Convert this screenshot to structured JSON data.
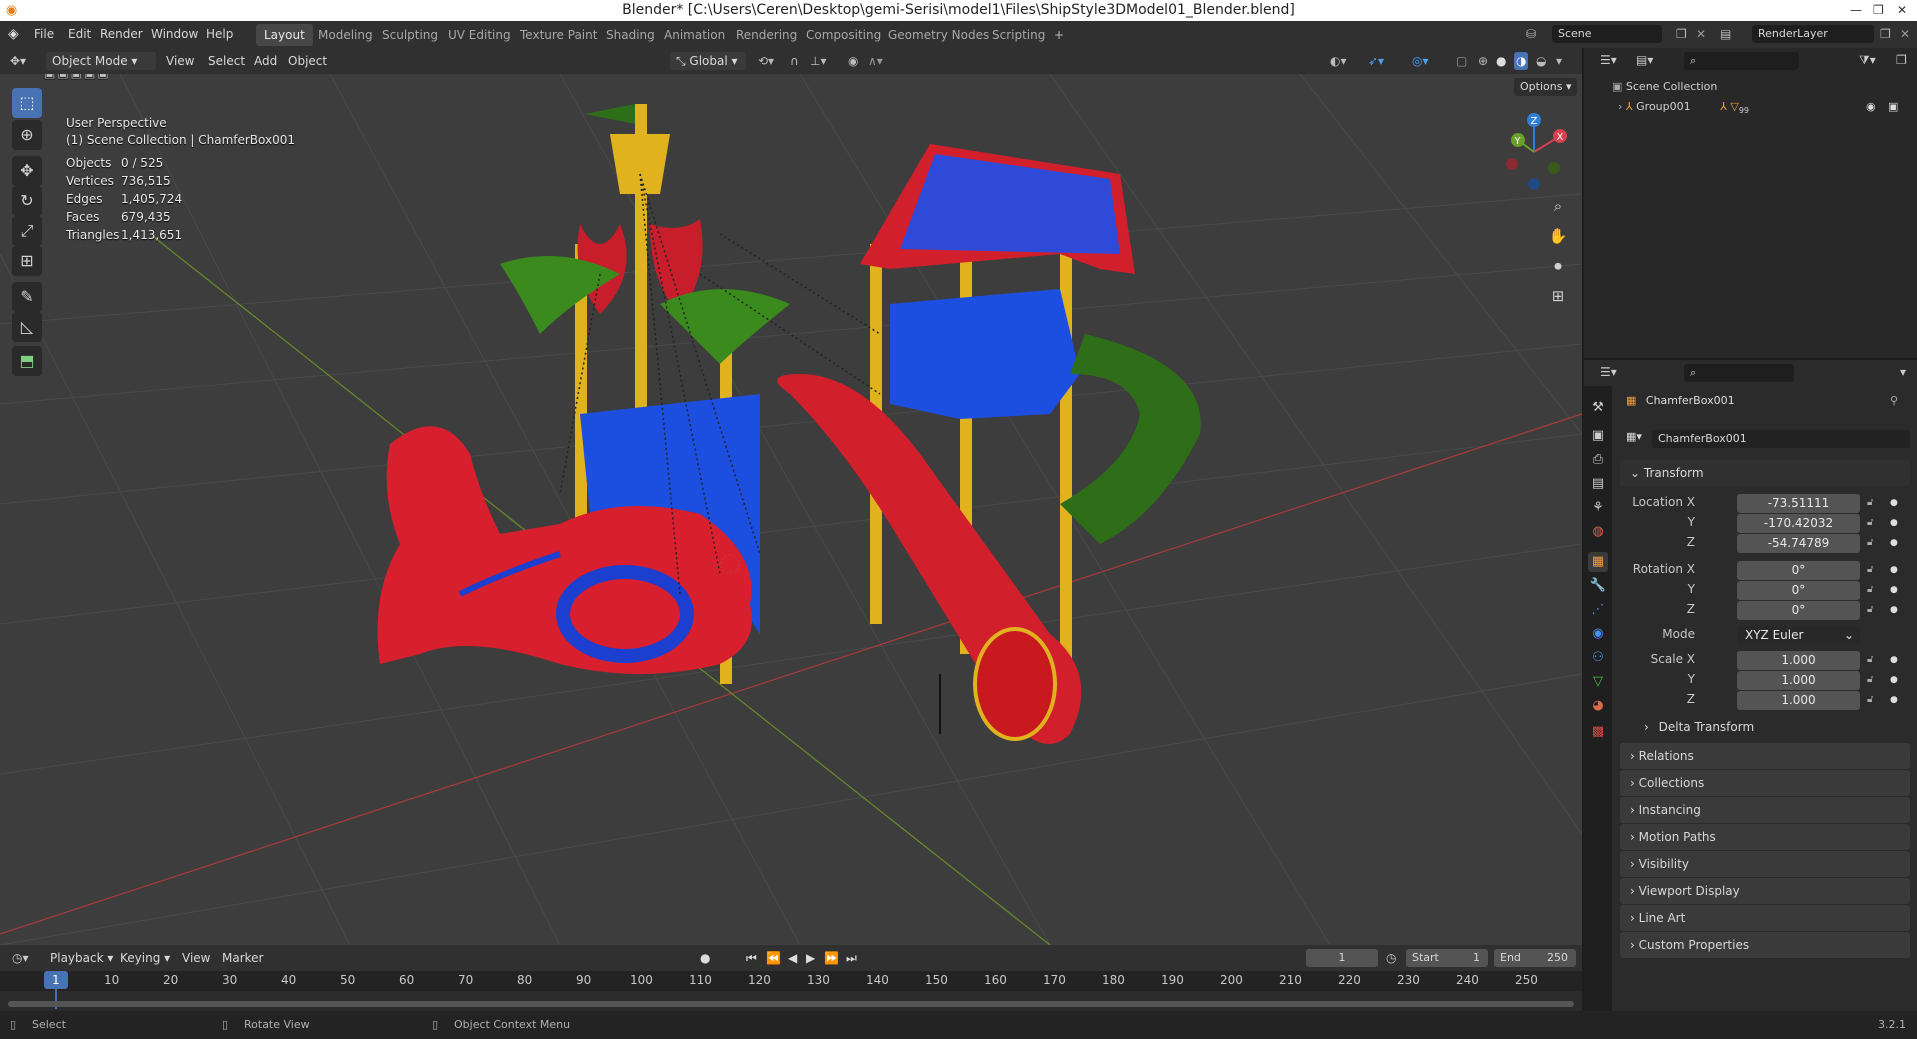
{
  "window": {
    "title": "Blender* [C:\\Users\\Ceren\\Desktop\\gemi-Serisi\\model1\\Files\\ShipStyle3DModel01_Blender.blend]"
  },
  "menu": {
    "items": [
      "File",
      "Edit",
      "Render",
      "Window",
      "Help"
    ]
  },
  "workspaces": {
    "tabs": [
      "Layout",
      "Modeling",
      "Sculpting",
      "UV Editing",
      "Texture Paint",
      "Shading",
      "Animation",
      "Rendering",
      "Compositing",
      "Geometry Nodes",
      "Scripting"
    ],
    "active": "Layout",
    "add": "+"
  },
  "scene": {
    "name": "Scene",
    "view_layer": "RenderLayer"
  },
  "viewport_header": {
    "mode": "Object Mode",
    "menus": [
      "View",
      "Select",
      "Add",
      "Object"
    ],
    "transform_orientation": "Global",
    "options": "Options"
  },
  "viewport_overlay": {
    "view_name": "User Perspective",
    "collection_info": "(1) Scene Collection | ChamferBox001",
    "stats": [
      {
        "label": "Objects",
        "value": "0 / 525"
      },
      {
        "label": "Vertices",
        "value": "736,515"
      },
      {
        "label": "Edges",
        "value": "1,405,724"
      },
      {
        "label": "Faces",
        "value": "679,435"
      },
      {
        "label": "Triangles",
        "value": "1,413,651"
      }
    ]
  },
  "gizmo": {
    "x": "X",
    "y": "Y",
    "z": "Z"
  },
  "outliner": {
    "root": "Scene Collection",
    "items": [
      {
        "name": "Group001",
        "badge": "99"
      }
    ]
  },
  "properties": {
    "object_name": "ChamferBox001",
    "datablock": "ChamferBox001",
    "transform_header": "Transform",
    "location": {
      "label_x": "Location X",
      "x": "-73.51111",
      "y": "-170.42032",
      "z": "-54.74789"
    },
    "rotation": {
      "label_x": "Rotation X",
      "x": "0°",
      "y": "0°",
      "z": "0°"
    },
    "mode_label": "Mode",
    "mode_value": "XYZ Euler",
    "scale": {
      "label_x": "Scale X",
      "x": "1.000",
      "y": "1.000",
      "z": "1.000"
    },
    "axis_y": "Y",
    "axis_z": "Z",
    "delta_transform": "Delta Transform",
    "panels": [
      "Relations",
      "Collections",
      "Instancing",
      "Motion Paths",
      "Visibility",
      "Viewport Display",
      "Line Art",
      "Custom Properties"
    ]
  },
  "timeline": {
    "menus": [
      "Playback",
      "Keying",
      "View",
      "Marker"
    ],
    "current_frame": "1",
    "start_label": "Start",
    "start": "1",
    "end_label": "End",
    "end": "250",
    "ruler": [
      "1",
      "10",
      "20",
      "30",
      "40",
      "50",
      "60",
      "70",
      "80",
      "90",
      "100",
      "110",
      "120",
      "130",
      "140",
      "150",
      "160",
      "170",
      "180",
      "190",
      "200",
      "210",
      "220",
      "230",
      "240",
      "250"
    ]
  },
  "statusbar": {
    "hints": [
      "Select",
      "Rotate View",
      "Object Context Menu"
    ],
    "version": "3.2.1"
  },
  "colors": {
    "accent": "#4772b3",
    "frame_marker": "#4772b3",
    "slide_red": "#d11f2c",
    "slide_green": "#2f6e18",
    "pole_yellow": "#e0b21e",
    "panel_blue": "#1c4fe0"
  }
}
